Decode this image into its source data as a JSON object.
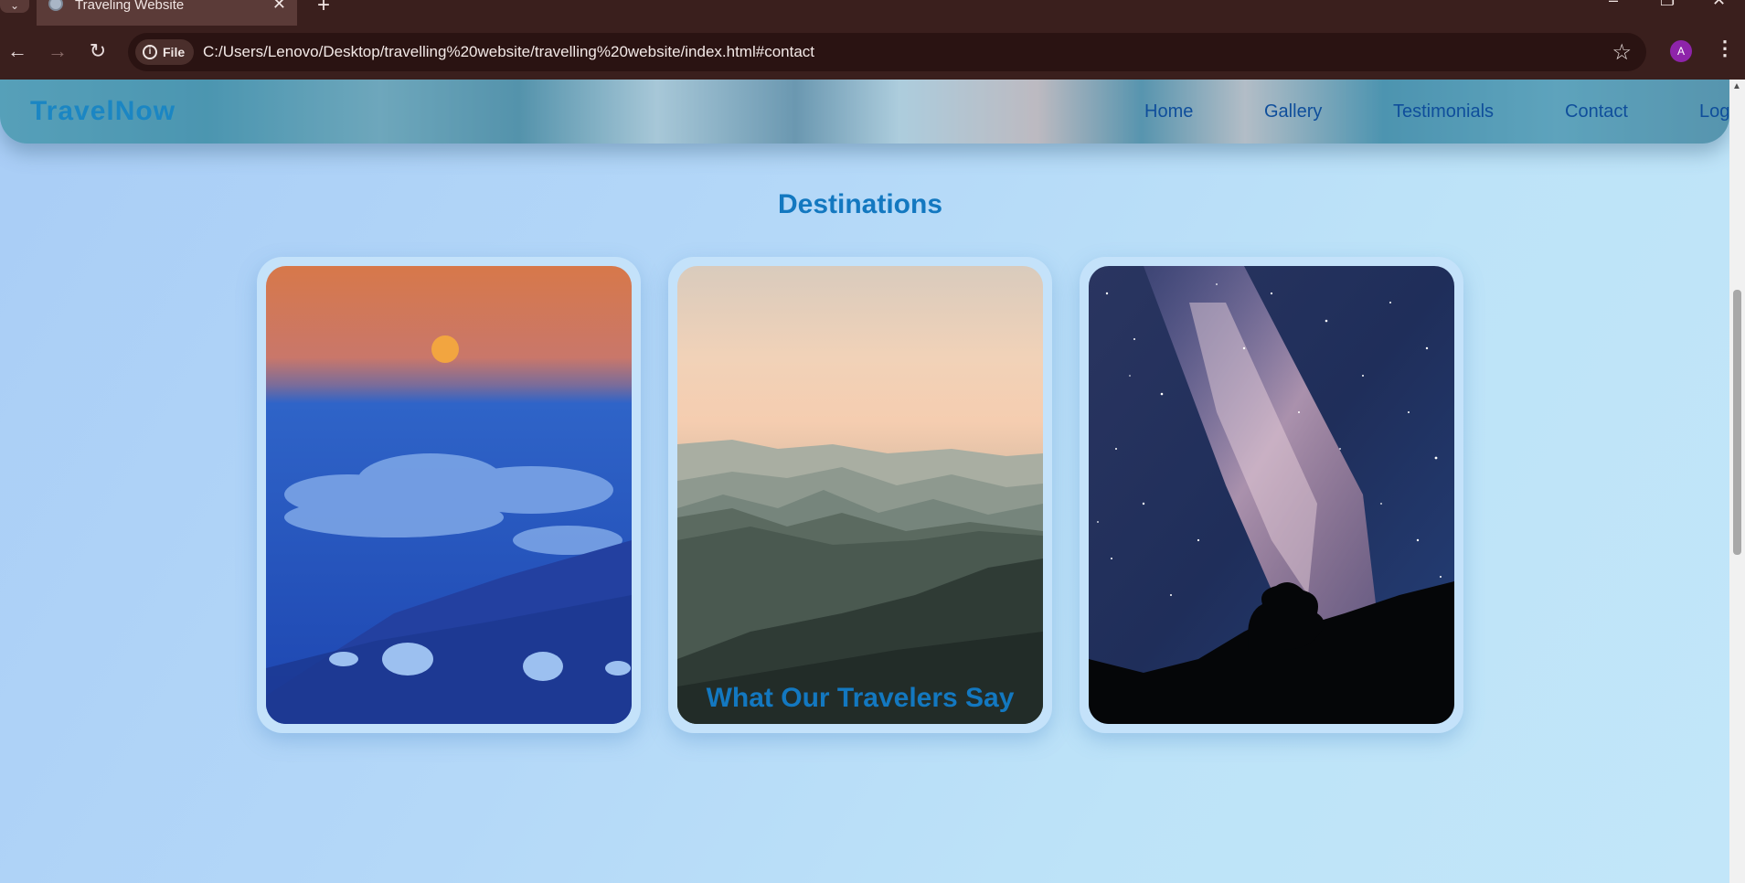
{
  "browser": {
    "tab_title": "Traveling Website",
    "new_tab": "+",
    "site_chip": "File",
    "url": "C:/Users/Lenovo/Desktop/travelling%20website/travelling%20website/index.html#contact",
    "profile_initial": "A"
  },
  "site": {
    "brand": "TravelNow",
    "nav": [
      "Home",
      "Gallery",
      "Testimonials",
      "Contact",
      "Log"
    ]
  },
  "destinations": {
    "title": "Destinations",
    "cards": [
      {
        "image": "moon-over-clouds-photo"
      },
      {
        "image": "misty-mountain-ranges-photo"
      },
      {
        "image": "milky-way-night-sky-photo"
      }
    ]
  },
  "testimonials": {
    "title": "What Our Travelers Say"
  },
  "colors": {
    "accent": "#1378c0",
    "nav_link": "#0f4e9b",
    "chrome_bg": "#3a1f1d"
  }
}
